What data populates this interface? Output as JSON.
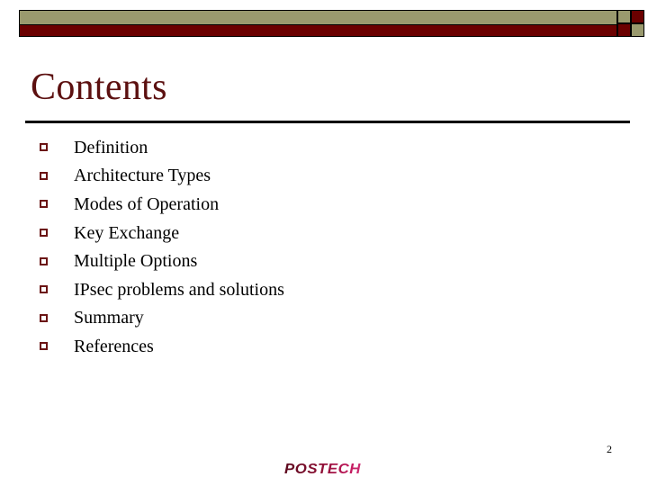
{
  "slide": {
    "title": "Contents",
    "page_number": "2",
    "logo_text": "POSTECH"
  },
  "theme": {
    "olive": "#9a9a6e",
    "maroon": "#6b0000",
    "title_color": "#5c1010",
    "bullet_color": "#6b1414",
    "text_color": "#000000",
    "background": "#ffffff"
  },
  "header": {
    "bar_top_color": "#9a9a6e",
    "bar_bottom_color": "#6b0000",
    "checker": [
      {
        "position": "top-left",
        "color": "#9a9a6e"
      },
      {
        "position": "top-right",
        "color": "#6b0000"
      },
      {
        "position": "bottom-left",
        "color": "#6b0000"
      },
      {
        "position": "bottom-right",
        "color": "#9a9a6e"
      }
    ]
  },
  "contents": {
    "items": [
      {
        "label": "Definition"
      },
      {
        "label": "Architecture Types"
      },
      {
        "label": "Modes of Operation"
      },
      {
        "label": "Key Exchange"
      },
      {
        "label": "Multiple Options"
      },
      {
        "label": "IPsec problems and solutions"
      },
      {
        "label": "Summary"
      },
      {
        "label": "References"
      }
    ]
  }
}
